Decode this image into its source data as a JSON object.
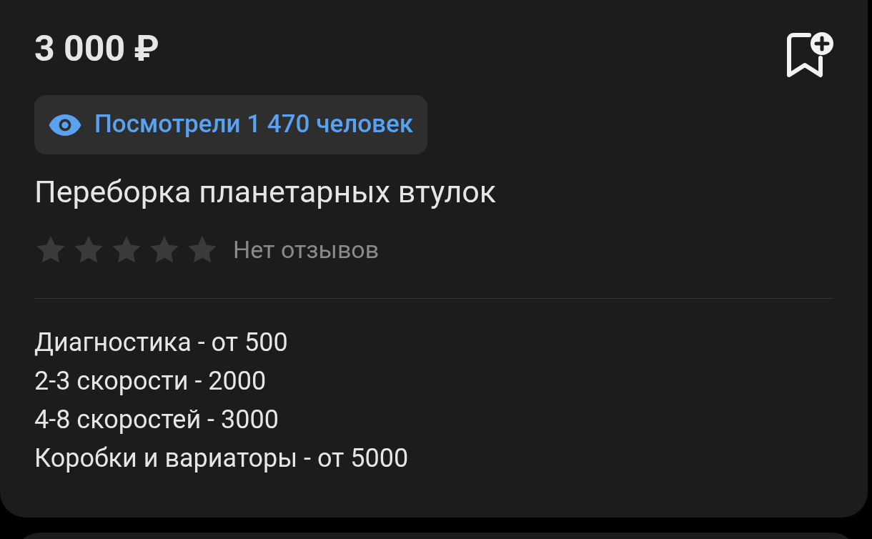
{
  "price": "3 000 ₽",
  "views_badge": "Посмотрели 1 470 человек",
  "title": "Переборка планетарных втулок",
  "rating": {
    "stars": 0,
    "reviews": "Нет отзывов"
  },
  "description": [
    "Диагностика - от 500",
    "2-3 скорости - 2000",
    "4-8 скоростей - 3000",
    "Коробки и вариаторы - от 5000"
  ]
}
